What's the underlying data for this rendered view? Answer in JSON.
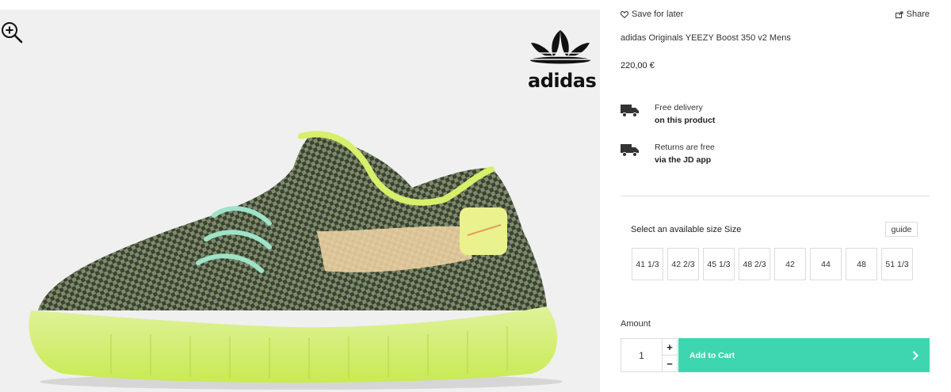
{
  "product": {
    "title": "adidas Originals YEEZY Boost 350 v2 Mens",
    "price": "220,00 €",
    "brand_wordmark": "adidas"
  },
  "actions": {
    "save_label": "Save for later",
    "share_label": "Share"
  },
  "perks": [
    {
      "line1": "Free delivery",
      "line2": "on this product",
      "icon": "truck-icon"
    },
    {
      "line1": "Returns are free",
      "line2": "via the JD app",
      "icon": "truck-icon"
    }
  ],
  "sizes": {
    "label": "Select an available size Size",
    "guide_label": "guide",
    "options": [
      "41 1/3",
      "42 2/3",
      "45 1/3",
      "48 2/3",
      "42",
      "44",
      "48",
      "51 1/3"
    ]
  },
  "purchase": {
    "amount_label": "Amount",
    "quantity": "1",
    "plus": "+",
    "minus": "−",
    "add_to_cart_label": "Add to Cart"
  },
  "colors": {
    "accent": "#3ed6b0",
    "gallery_bg": "#f0f0f0"
  }
}
